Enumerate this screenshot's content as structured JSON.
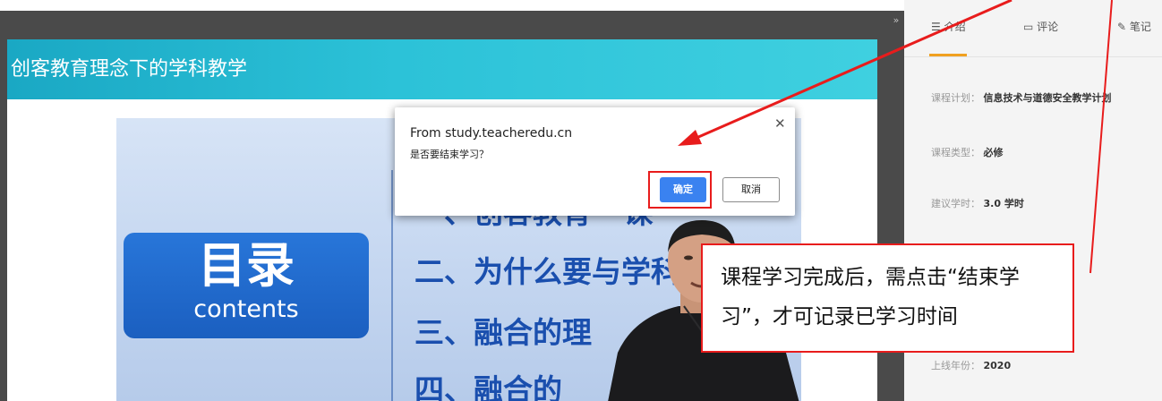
{
  "course": {
    "title": "创客教育理念下的学科教学"
  },
  "video": {
    "toc_title": "目录",
    "toc_subtitle": "contents",
    "lines": [
      "一、创客教育 · 课",
      "二、为什么要与学科",
      "三、融合的理",
      "四、融合的"
    ]
  },
  "side_panel": {
    "collapse_icon": "»",
    "tabs": [
      {
        "icon": "list-icon",
        "glyph": "☰",
        "label": "介绍",
        "active": true
      },
      {
        "icon": "comment-icon",
        "glyph": "▭",
        "label": "评论",
        "active": false
      },
      {
        "icon": "pencil-icon",
        "glyph": "✎",
        "label": "笔记",
        "active": false
      }
    ],
    "info": {
      "plan_label": "课程计划：",
      "plan_value": "信息技术与道德安全教学计划",
      "type_label": "课程类型：",
      "type_value": "必修",
      "hours_label": "建议学时：",
      "hours_value": "3.0 学时",
      "year_label": "上线年份：",
      "year_value": "2020"
    }
  },
  "dialog": {
    "origin": "From study.teacheredu.cn",
    "message": "是否要结束学习？",
    "close_glyph": "✕",
    "ok_label": "确定",
    "cancel_label": "取消"
  },
  "annotation": {
    "text": "课程学习完成后，需点击“结束学习”，才可记录已学习时间"
  },
  "colors": {
    "title_bar": "#2cc2d8",
    "accent_tab": "#f0a020",
    "ok_button": "#3a82f0",
    "annotation_red": "#e81c1c",
    "player_bg": "#4a4a4a"
  }
}
